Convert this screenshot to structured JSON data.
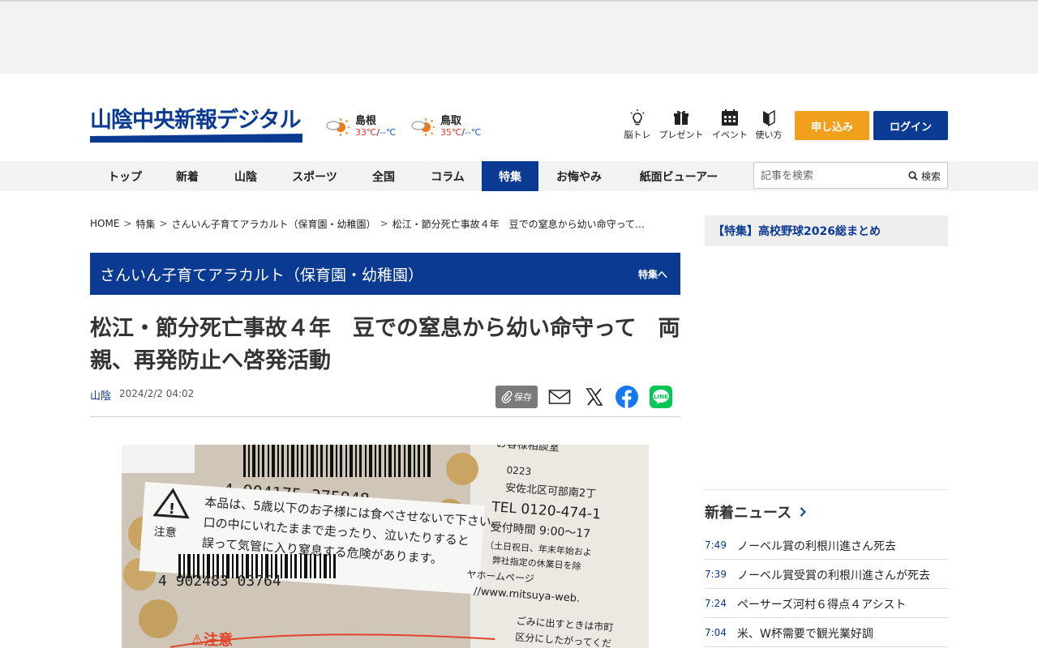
{
  "site": {
    "logo_text": "山陰中央新報デジタル",
    "brand_color": "#0a3a92",
    "accent_color": "#f1a01b"
  },
  "weather": [
    {
      "name": "島根",
      "high": "33℃",
      "sep": "/",
      "low": "--℃",
      "icon": "sun-cloud-icon"
    },
    {
      "name": "鳥取",
      "high": "35℃",
      "sep": "/",
      "low": "--℃",
      "icon": "sun-cloud-icon"
    }
  ],
  "utility": [
    {
      "label": "脳トレ",
      "icon": "lightbulb-icon"
    },
    {
      "label": "プレゼント",
      "icon": "gift-icon"
    },
    {
      "label": "イベント",
      "icon": "calendar-icon"
    },
    {
      "label": "使い方",
      "icon": "beginner-mark-icon"
    }
  ],
  "buttons": {
    "apply": "申し込み",
    "login": "ログイン"
  },
  "nav": {
    "items": [
      "トップ",
      "新着",
      "山陰",
      "スポーツ",
      "全国",
      "コラム",
      "特集",
      "お悔やみ",
      "紙面ビューアー"
    ],
    "active": "特集"
  },
  "search": {
    "placeholder": "記事を検索",
    "button": "検索"
  },
  "breadcrumb": [
    "HOME",
    "特集",
    "さんいん子育てアラカルト（保育園・幼稚園）",
    "松江・節分死亡事故４年　豆での窒息から幼い命守って…"
  ],
  "feature_banner": {
    "title": "さんいん子育てアラカルト（保育園・幼稚園）",
    "link": "特集へ"
  },
  "article": {
    "headline": "松江・節分死亡事故４年　豆での窒息から幼い命守って　両親、再発防止へ啓発活動",
    "region": "山陰",
    "date": "2024/2/2 04:02",
    "save_label": "保存"
  },
  "photo": {
    "barcode_top": "4 904175 375948",
    "barcode_bottom": "4 902483 03764",
    "warning_label": "注意",
    "warning_lines": [
      "本品は、5歳以下のお子様には食べさせないで下さい。",
      "口の中にいれたままで走ったり、泣いたりすると",
      "誤って気管に入り窒息する危険があります。"
    ],
    "contact_lines": [
      "お客様相談室",
      "0223",
      "安佐北区可部南2丁",
      "TEL 0120-474-1",
      "受付時間 9:00〜17",
      "（土日祝日、年末年始およ",
      "弊社指定の休業日を除",
      "ヤホームページ",
      "//www.mitsuya-web.",
      "ごみに出すときは市町",
      "区分にしたがってくだ"
    ],
    "bottom_warning": "⚠注意"
  },
  "sidebar": {
    "feature": "【特集】高校野球2026総まとめ",
    "news_title": "新着ニュース",
    "news": [
      {
        "time": "7:49",
        "title": "ノーベル賞の利根川進さん死去"
      },
      {
        "time": "7:39",
        "title": "ノーベル賞受賞の利根川進さんが死去"
      },
      {
        "time": "7:24",
        "title": "ペーサーズ河村６得点４アシスト"
      },
      {
        "time": "7:04",
        "title": "米、W杯需要で観光業好調"
      }
    ]
  }
}
